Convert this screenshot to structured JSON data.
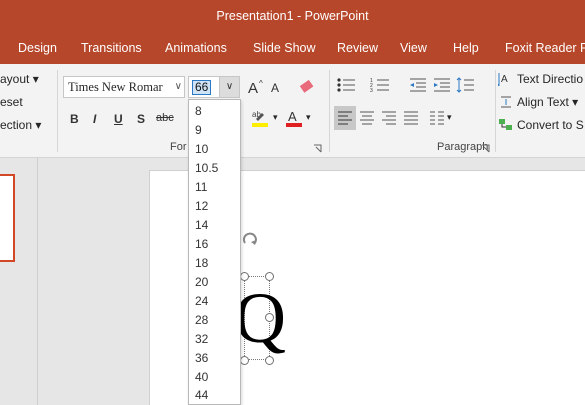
{
  "title": "Presentation1  -  PowerPoint",
  "tabs": [
    "Design",
    "Transitions",
    "Animations",
    "Slide Show",
    "Review",
    "View",
    "Help",
    "Foxit Reader PD"
  ],
  "slides_group": {
    "layout": "ayout ▾",
    "reset": "eset",
    "section": "ection ▾"
  },
  "font": {
    "name": "Times New Romar",
    "size": "66",
    "group_label": "For"
  },
  "format_buttons": {
    "bold": "B",
    "italic": "I",
    "underline": "U",
    "shadow": "S",
    "strike": "abc"
  },
  "paragraph": {
    "group_label": "Paragraph",
    "text_direction": "Text Directio",
    "align_text": "Align Text ▾",
    "convert": "Convert to S"
  },
  "size_options": [
    "8",
    "9",
    "10",
    "10.5",
    "11",
    "12",
    "14",
    "16",
    "18",
    "20",
    "24",
    "28",
    "32",
    "36",
    "40",
    "44"
  ],
  "slide": {
    "letter": "Q"
  },
  "colors": {
    "brand": "#b7472a",
    "accent_red": "#d24726"
  }
}
